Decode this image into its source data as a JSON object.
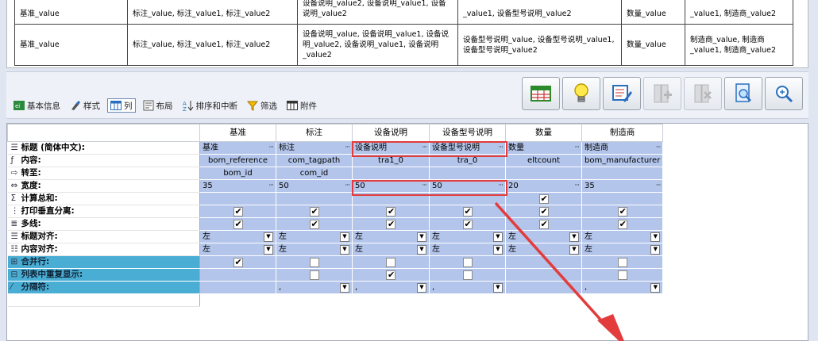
{
  "preview": {
    "rows": [
      [
        "基准_value",
        "标注_value, 标注_value1, 标注_value2",
        "设备说明_value2, 设备说明_value1, 设备说明_value2",
        "_value1, 设备型号说明_value2",
        "数量_value",
        "_value1, 制造商_value2"
      ],
      [
        "基准_value",
        "标注_value, 标注_value1, 标注_value2",
        "设备说明_value, 设备说明_value1, 设备说明_value2, 设备说明_value1, 设备说明_value2",
        "设备型号说明_value, 设备型号说明_value1, 设备型号说明_value2",
        "数量_value",
        "制造商_value, 制造商_value1, 制造商_value2"
      ]
    ]
  },
  "tabs": [
    {
      "label": "基本信息",
      "icon": "info-icon"
    },
    {
      "label": "样式",
      "icon": "brush-icon"
    },
    {
      "label": "列",
      "icon": "columns-icon"
    },
    {
      "label": "布局",
      "icon": "layout-icon"
    },
    {
      "label": "排序和中断",
      "icon": "sort-icon"
    },
    {
      "label": "筛选",
      "icon": "filter-icon"
    },
    {
      "label": "附件",
      "icon": "attachment-icon"
    }
  ],
  "grid": {
    "columns": [
      "基准",
      "标注",
      "设备说明",
      "设备型号说明",
      "数量",
      "制造商"
    ],
    "labels": {
      "title": "标题 (简体中文):",
      "content": "内容:",
      "goto": "转至:",
      "width": "宽度:",
      "sum": "计算总和:",
      "print_vsep": "打印垂直分离:",
      "multiline": "多线:",
      "title_align": "标题对齐:",
      "content_align": "内容对齐:",
      "merge_rows": "合并行:",
      "repeat_display": "列表中重复显示:",
      "separator": "分隔符:"
    },
    "title": [
      "基准",
      "标注",
      "设备说明",
      "设备型号说明",
      "数量",
      "制造商"
    ],
    "content": [
      "bom_reference",
      "com_tagpath",
      "tra1_0",
      "tra_0",
      "eltcount",
      "bom_manufacturer"
    ],
    "goto": [
      "bom_id",
      "com_id",
      "",
      "",
      "",
      ""
    ],
    "width": [
      "35",
      "50",
      "50",
      "50",
      "20",
      "35"
    ],
    "align": [
      "左",
      "左",
      "左",
      "左",
      "左",
      "左"
    ],
    "separator": [
      "",
      ",",
      ",",
      ",",
      "",
      ","
    ]
  }
}
